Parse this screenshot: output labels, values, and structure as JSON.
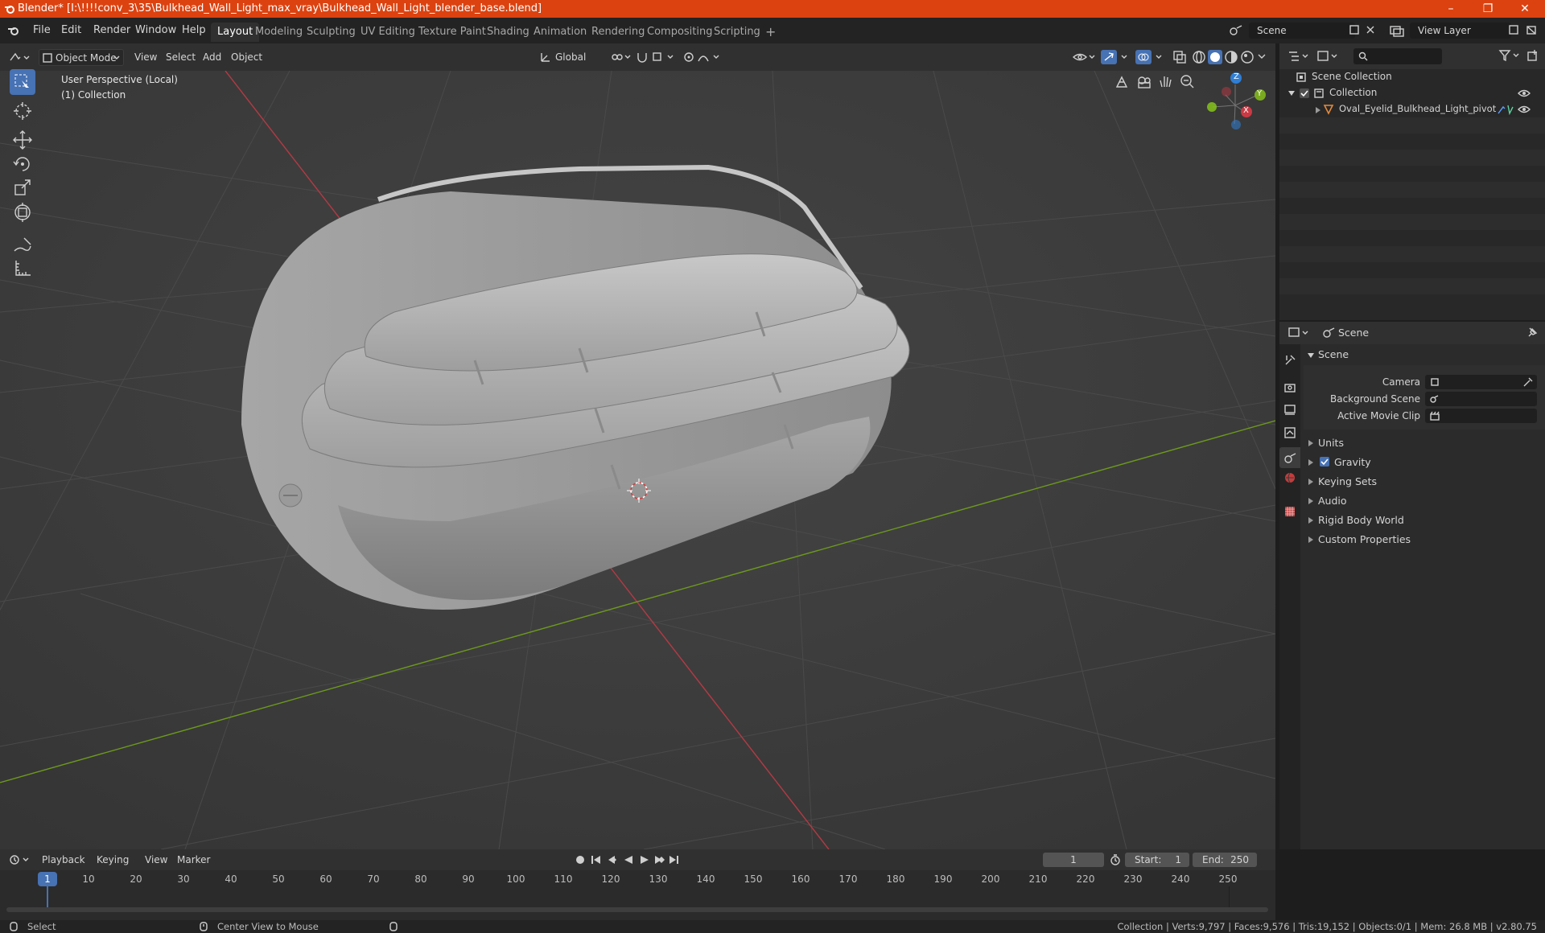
{
  "window": {
    "title": "Blender* [I:\\!!!!conv_3\\35\\Bulkhead_Wall_Light_max_vray\\Bulkhead_Wall_Light_blender_base.blend]",
    "minimize": "–",
    "maximize": "❐",
    "close": "✕"
  },
  "menu": {
    "items": [
      "File",
      "Edit",
      "Render",
      "Window",
      "Help"
    ]
  },
  "workspaces": {
    "tabs": [
      "Layout",
      "Modeling",
      "Sculpting",
      "UV Editing",
      "Texture Paint",
      "Shading",
      "Animation",
      "Rendering",
      "Compositing",
      "Scripting"
    ],
    "active": "Layout",
    "add": "+"
  },
  "scene_selector": {
    "value": "Scene"
  },
  "view_layer": {
    "value": "View Layer"
  },
  "viewport_header": {
    "mode": "Object Mode",
    "menus": [
      "View",
      "Select",
      "Add",
      "Object"
    ],
    "transform_orientation": "Global"
  },
  "viewport": {
    "perspective": "User Perspective (Local)",
    "collection": "(1) Collection",
    "gizmo_axes": {
      "x": "X",
      "y": "Y",
      "z": "Z"
    }
  },
  "outliner": {
    "root": "Scene Collection",
    "collection": "Collection",
    "object": "Oval_Eyelid_Bulkhead_Light_pivot"
  },
  "properties": {
    "context": "Scene",
    "panel": "Scene",
    "fields": {
      "camera": "Camera",
      "background_scene": "Background Scene",
      "active_movie_clip": "Active Movie Clip"
    },
    "sections": [
      "Units",
      "Gravity",
      "Keying Sets",
      "Audio",
      "Rigid Body World",
      "Custom Properties"
    ]
  },
  "timeline": {
    "menus": [
      "Playback",
      "Keying",
      "View",
      "Marker"
    ],
    "current_frame": "1",
    "start_label": "Start:",
    "start": "1",
    "end_label": "End:",
    "end": "250",
    "ticks": [
      "1",
      "10",
      "20",
      "30",
      "40",
      "50",
      "60",
      "70",
      "80",
      "90",
      "100",
      "110",
      "120",
      "130",
      "140",
      "150",
      "160",
      "170",
      "180",
      "190",
      "200",
      "210",
      "220",
      "230",
      "240",
      "250"
    ]
  },
  "status": {
    "left": "Select",
    "middle": "Center View to Mouse",
    "right": "Collection | Verts:9,797 | Faces:9,576 | Tris:19,152 | Objects:0/1 | Mem: 26.8 MB | v2.80.75"
  },
  "colors": {
    "title_bar": "#dc4210",
    "active_tool": "#4772b3",
    "x_axis": "#c93a45",
    "y_axis": "#7aaa1f",
    "z_axis": "#2f7fd6"
  }
}
